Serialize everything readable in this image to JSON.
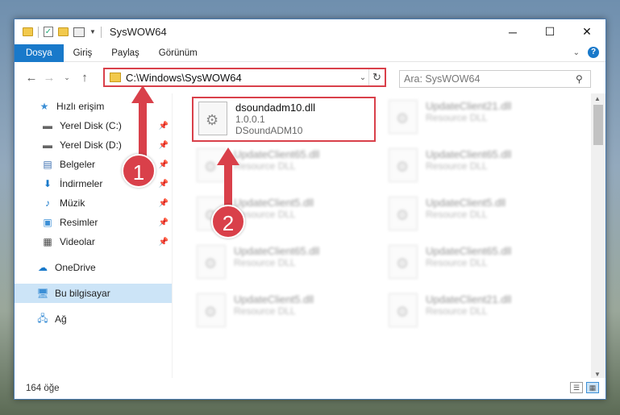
{
  "window": {
    "title": "SysWOW64"
  },
  "ribbon": {
    "tabs": [
      "Dosya",
      "Giriş",
      "Paylaş",
      "Görünüm"
    ],
    "help": "?"
  },
  "address": {
    "path": "C:\\Windows\\SysWOW64"
  },
  "search": {
    "placeholder": "Ara: SysWOW64"
  },
  "sidebar": {
    "items": [
      {
        "label": "Hızlı erişim",
        "icon": "star-icon"
      },
      {
        "label": "Yerel Disk (C:)",
        "icon": "drive-icon"
      },
      {
        "label": "Yerel Disk (D:)",
        "icon": "drive-icon"
      },
      {
        "label": "Belgeler",
        "icon": "document-icon"
      },
      {
        "label": "İndirmeler",
        "icon": "download-icon"
      },
      {
        "label": "Müzik",
        "icon": "music-icon"
      },
      {
        "label": "Resimler",
        "icon": "pictures-icon"
      },
      {
        "label": "Videolar",
        "icon": "video-icon"
      },
      {
        "label": "OneDrive",
        "icon": "cloud-icon"
      },
      {
        "label": "Bu bilgisayar",
        "icon": "computer-icon"
      },
      {
        "label": "Ağ",
        "icon": "network-icon"
      }
    ]
  },
  "files": {
    "highlighted": {
      "name": "dsoundadm10.dll",
      "version": "1.0.0.1",
      "desc": "DSoundADM10"
    },
    "blurred": [
      {
        "name": "UpdateClient21.dll",
        "desc": "Resource DLL"
      },
      {
        "name": "UpdateClient65.dll",
        "desc": "Resource DLL"
      },
      {
        "name": "UpdateClient65.dll",
        "desc": "Resource DLL"
      },
      {
        "name": "UpdateClient5.dll",
        "desc": "Resource DLL"
      },
      {
        "name": "UpdateClient5.dll",
        "desc": "Resource DLL"
      },
      {
        "name": "UpdateClient65.dll",
        "desc": "Resource DLL"
      },
      {
        "name": "UpdateClient65.dll",
        "desc": "Resource DLL"
      },
      {
        "name": "UpdateClient5.dll",
        "desc": "Resource DLL"
      },
      {
        "name": "UpdateClient21.dll",
        "desc": "Resource DLL"
      }
    ]
  },
  "status": {
    "count": "164 öğe"
  },
  "annotations": {
    "step1": "1",
    "step2": "2"
  },
  "colors": {
    "accent": "#1979ca",
    "highlight": "#d9404a",
    "selected": "#cce4f7"
  }
}
